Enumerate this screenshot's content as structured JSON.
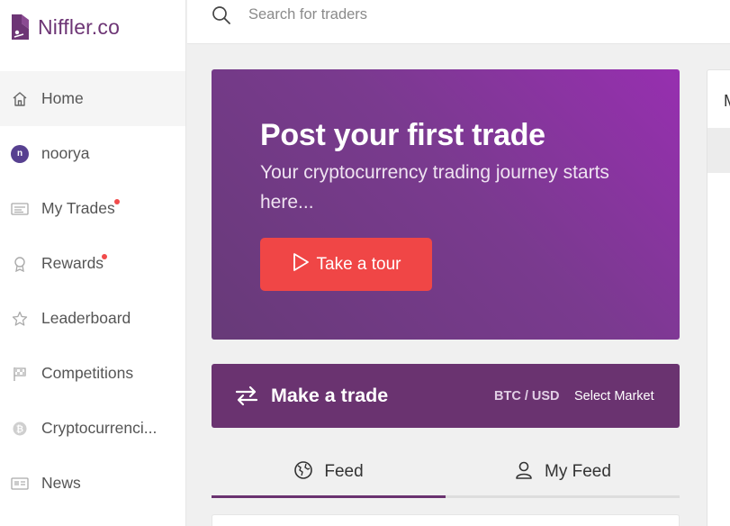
{
  "brand": {
    "name": "Niffler",
    "suffix": ".co",
    "color": "#6d3575"
  },
  "search": {
    "placeholder": "Search for traders"
  },
  "sidebar": {
    "items": [
      {
        "label": "Home",
        "icon": "home-icon",
        "active": true
      },
      {
        "label": "noorya",
        "icon": "avatar",
        "avatar_letter": "n"
      },
      {
        "label": "My Trades",
        "icon": "trades-icon",
        "notification": true
      },
      {
        "label": "Rewards",
        "icon": "award-icon",
        "notification": true
      },
      {
        "label": "Leaderboard",
        "icon": "star-icon"
      },
      {
        "label": "Competitions",
        "icon": "flag-icon"
      },
      {
        "label": "Cryptocurrenci...",
        "icon": "bitcoin-icon"
      },
      {
        "label": "News",
        "icon": "newspaper-icon"
      }
    ]
  },
  "hero": {
    "title": "Post your first trade",
    "subtitle": "Your cryptocurrency trading journey starts here...",
    "button_label": "Take a tour"
  },
  "trade": {
    "title": "Make a trade",
    "pair": "BTC / USD",
    "market_label": "Select Market"
  },
  "tabs": [
    {
      "label": "Feed",
      "icon": "globe-icon",
      "active": true
    },
    {
      "label": "My Feed",
      "icon": "user-icon",
      "active": false
    }
  ],
  "right_panel": {
    "header_letter": "M"
  },
  "colors": {
    "accent": "#6a3370",
    "button": "#f04646",
    "notification": "#f14b4b",
    "hero_gradient_start": "#972fb0",
    "hero_gradient_end": "#673a78"
  }
}
